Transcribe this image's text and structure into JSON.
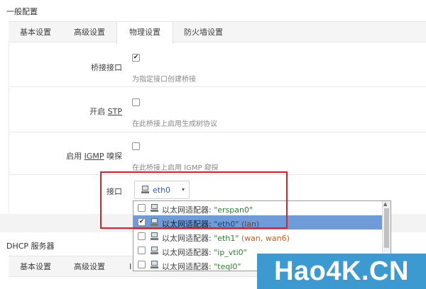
{
  "section1": {
    "title": "一般配置",
    "tabs": [
      {
        "label": "基本设置",
        "active": false
      },
      {
        "label": "高级设置",
        "active": false
      },
      {
        "label": "物理设置",
        "active": true
      },
      {
        "label": "防火墙设置",
        "active": false
      }
    ]
  },
  "fields": {
    "bridge": {
      "label": "桥接接口",
      "checked": true,
      "desc": "为指定接口创建桥接"
    },
    "stp": {
      "label_prefix": "开启 ",
      "label_link": "STP",
      "checked": false,
      "desc": "在此桥接上启用生成树协议"
    },
    "igmp": {
      "label_prefix": "启用 ",
      "label_link": "IGMP",
      "label_suffix": " 嗅探",
      "checked": false,
      "desc": "在此桥接上启用 IGMP 窥探"
    },
    "interface": {
      "label": "接口",
      "selected": "eth0",
      "caret": "▾"
    }
  },
  "dropdown": {
    "options": [
      {
        "prefix": "以太网适配器: ",
        "name": "\"erspan0\"",
        "networks": "",
        "checked": false,
        "selected": false
      },
      {
        "prefix": "以太网适配器: ",
        "name": "\"eth0\"",
        "networks": " (lan)",
        "checked": true,
        "selected": true
      },
      {
        "prefix": "以太网适配器: ",
        "name": "\"eth1\"",
        "networks": " (wan, wan6)",
        "checked": false,
        "selected": false
      },
      {
        "prefix": "以太网适配器: ",
        "name": "\"ip_vti0\"",
        "networks": "",
        "checked": false,
        "selected": false
      },
      {
        "prefix": "以太网适配器: ",
        "name": "\"teql0\"",
        "networks": "",
        "checked": false,
        "selected": false
      }
    ]
  },
  "section2": {
    "title": "DHCP 服务器",
    "tabs": [
      {
        "label": "基本设置"
      },
      {
        "label": "高级设置"
      },
      {
        "label": "I"
      }
    ]
  },
  "watermark": {
    "text": "Hao4K.CN"
  },
  "colors": {
    "highlight": "#e02020",
    "selected_row": "#6f9bd8",
    "watermark_bg": "#3d9ad1"
  }
}
